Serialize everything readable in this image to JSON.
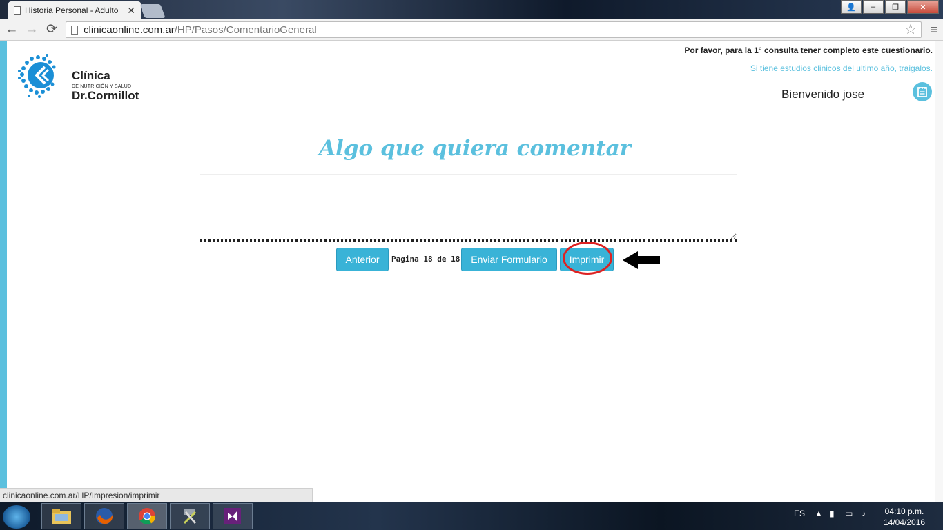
{
  "browser": {
    "tab_title": "Historia Personal - Adulto",
    "tab_close": "✕",
    "window_buttons": {
      "user": "👤",
      "minimize": "–",
      "restore": "❐",
      "close": "✕"
    },
    "nav": {
      "back": "←",
      "forward": "→",
      "reload": "⟳"
    },
    "url_host": "clinicaonline.com.ar",
    "url_path": "/HP/Pasos/ComentarioGeneral",
    "star": "☆",
    "menu": "≡"
  },
  "header": {
    "brand_line1": "Clínica",
    "brand_line2": "DE NUTRICIÓN Y SALUD",
    "brand_line3": "Dr.Cormillot",
    "notice": "Por favor, para la 1° consulta tener completo este cuestionario.",
    "studies_link": "Si tiene estudios clinicos del ultimo año, traigalos.",
    "welcome": "Bienvenido jose"
  },
  "main": {
    "heading": "Algo que quiera comentar",
    "comment_value": "",
    "prev_button": "Anterior",
    "pagination": "Pagina 18 de 18",
    "submit_button": "Enviar Formulario",
    "print_button": "Imprimir"
  },
  "status_bar": "clinicaonline.com.ar/HP/Impresion/imprimir",
  "taskbar": {
    "language": "ES",
    "time": "04:10 p.m.",
    "date": "14/04/2016",
    "apps": [
      "file-explorer",
      "firefox",
      "chrome",
      "tools",
      "visual-studio"
    ]
  },
  "colors": {
    "accent": "#5bc0de",
    "button": "#39b3d7",
    "annotation": "#dd2222"
  }
}
